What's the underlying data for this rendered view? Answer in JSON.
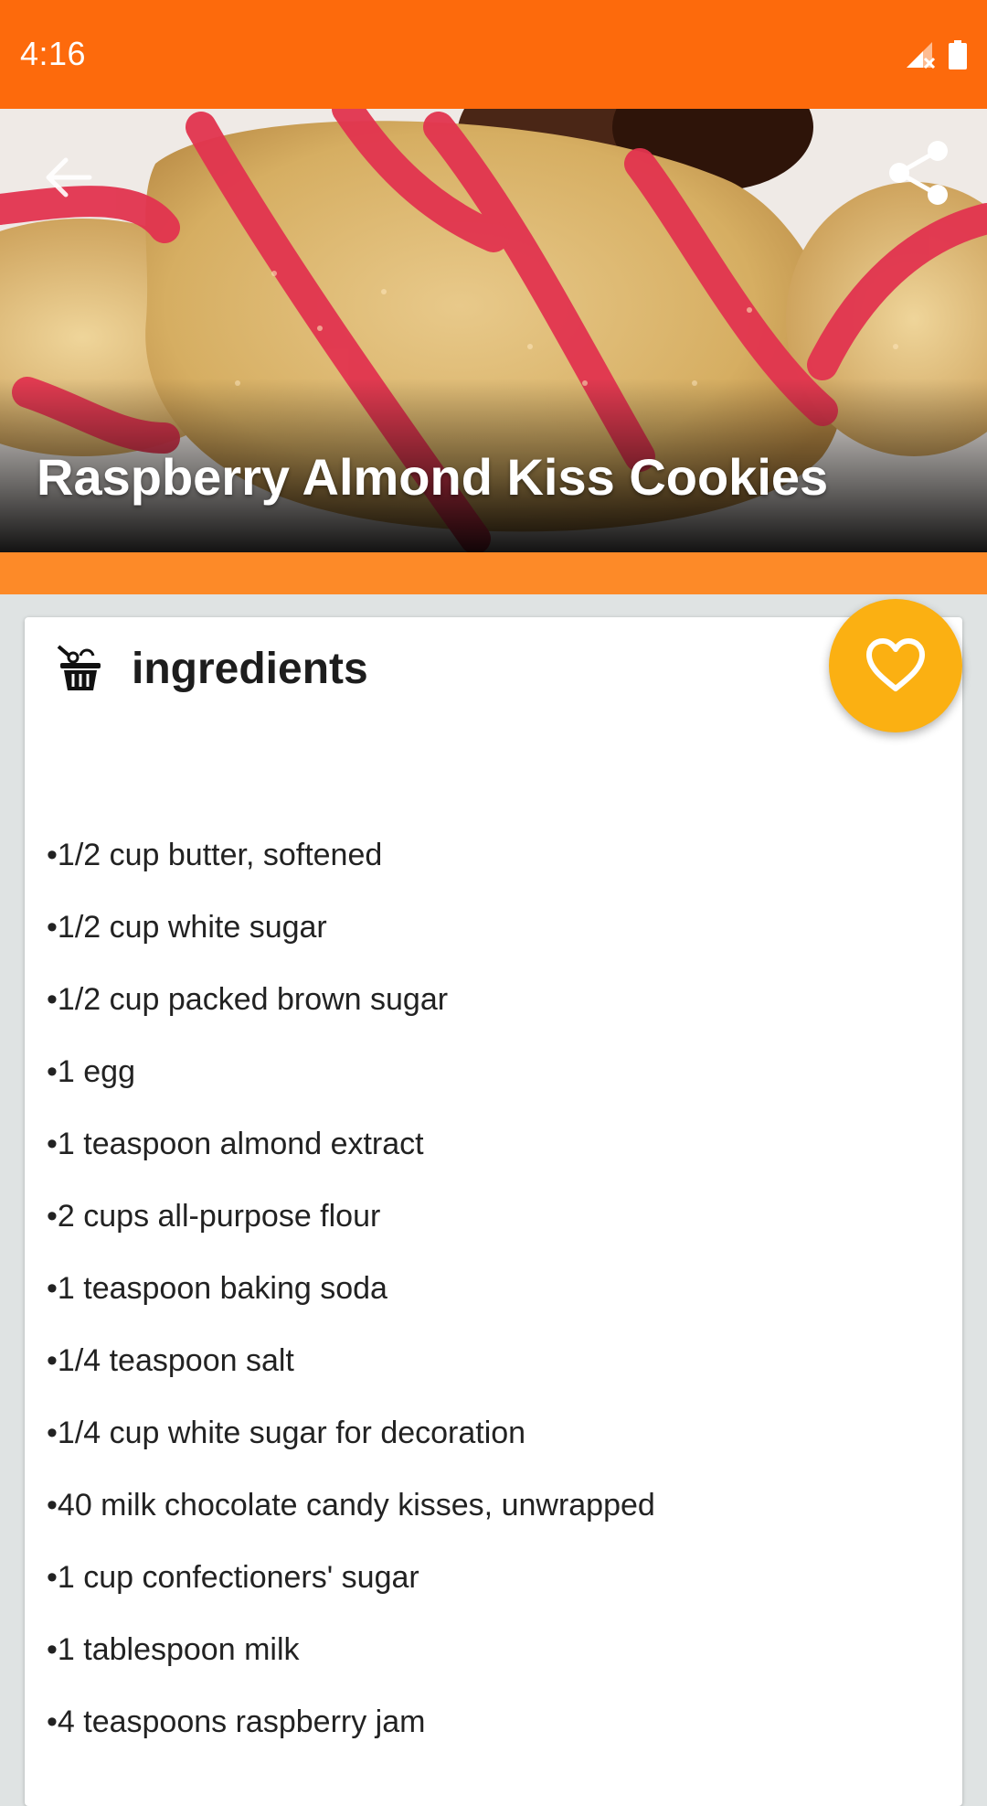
{
  "status_bar": {
    "time": "4:16",
    "signal_icon": "signal-off-icon",
    "battery_icon": "battery-full-icon"
  },
  "hero": {
    "title": "Raspberry Almond Kiss Cookies",
    "back_icon": "arrow-back-icon",
    "share_icon": "share-icon"
  },
  "ingredients": {
    "heading": "ingredients",
    "icon": "basket-icon",
    "items": [
      "•1/2 cup butter, softened",
      "•1/2 cup white sugar",
      "•1/2 cup packed brown sugar",
      "•1 egg",
      "•1 teaspoon almond extract",
      "•2 cups all-purpose flour",
      "•1 teaspoon baking soda",
      "•1/4 teaspoon salt",
      "•1/4 cup white sugar for decoration",
      "•40 milk chocolate candy kisses, unwrapped",
      "•1 cup confectioners' sugar",
      "•1 tablespoon milk",
      "•4 teaspoons raspberry jam"
    ]
  },
  "favorite": {
    "icon": "heart-outline-icon"
  },
  "colors": {
    "status_bar": "#fd6a0c",
    "accent_strip": "#fd8a28",
    "fab": "#fbb012",
    "background": "#dfe3e3"
  }
}
